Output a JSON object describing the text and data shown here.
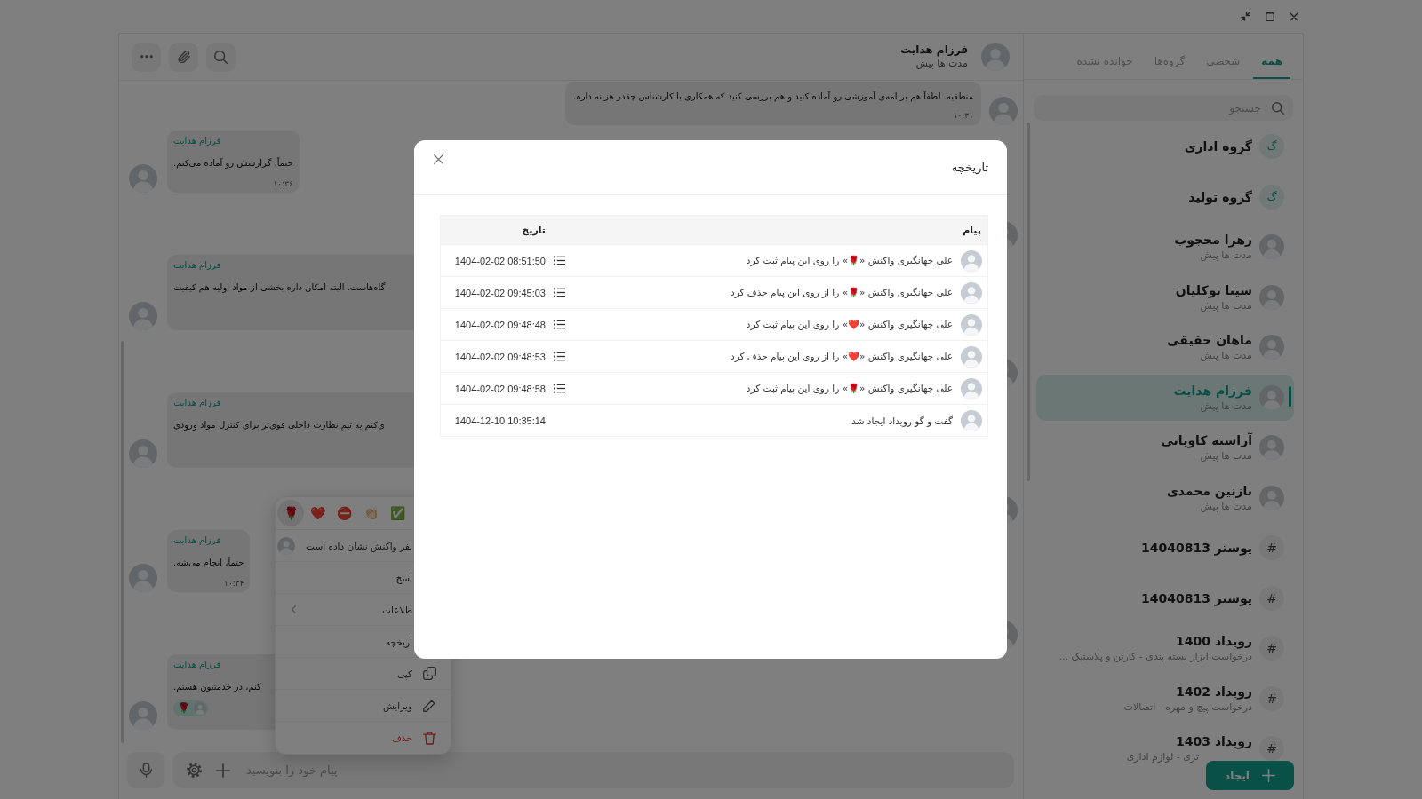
{
  "sidebar": {
    "tabs": [
      {
        "label": "همه",
        "selected": true
      },
      {
        "label": "شخصی",
        "selected": false
      },
      {
        "label": "گروه‌ها",
        "selected": false
      },
      {
        "label": "خوانده نشده",
        "selected": false
      }
    ],
    "search": {
      "placeholder": "جستجو"
    },
    "chats": [
      {
        "kind": "group",
        "badge": "گ",
        "title": "گروه اداری",
        "selected": false
      },
      {
        "kind": "group",
        "badge": "گ",
        "title": "گروه تولید",
        "selected": false
      },
      {
        "kind": "person",
        "title": "زهرا محجوب",
        "subtitle": "مدت ها پیش",
        "selected": false
      },
      {
        "kind": "person",
        "title": "سینا توکلیان",
        "subtitle": "مدت ها پیش",
        "selected": false
      },
      {
        "kind": "person",
        "title": "ماهان حقیقی",
        "subtitle": "مدت ها پیش",
        "selected": false
      },
      {
        "kind": "person",
        "title": "فرزام هدایت",
        "subtitle": "مدت ها پیش",
        "selected": true
      },
      {
        "kind": "person",
        "title": "آراسته کاویانی",
        "subtitle": "مدت ها پیش",
        "selected": false
      },
      {
        "kind": "person",
        "title": "نازنین محمدی",
        "subtitle": "مدت ها پیش",
        "selected": false
      },
      {
        "kind": "channel",
        "badge": "#",
        "title": "پوستر 14040813",
        "selected": false
      },
      {
        "kind": "channel",
        "badge": "#",
        "title": "پوستر 14040813",
        "selected": false
      },
      {
        "kind": "channel",
        "badge": "#",
        "title": "رویداد 1400",
        "subtitle": "درخواست ابزار بسته بندی - کارتن و پلاستیک ...",
        "selected": false
      },
      {
        "kind": "channel",
        "badge": "#",
        "title": "رویداد 1402",
        "subtitle": "درخواست پیچ و مهره - اتصالات",
        "selected": false
      },
      {
        "kind": "channel",
        "badge": "#",
        "title": "رویداد 1403",
        "subtitle": "تری - لوازم اداری",
        "selected": false
      }
    ],
    "create_button": "ایجاد"
  },
  "chat": {
    "header": {
      "name": "فرزام هدایت",
      "status": "مدت ها پیش"
    },
    "messages": [
      {
        "kind": "sent",
        "text": "منطقیه. لطفاً هم برنامه‌ی آموزشی رو آماده کنید و هم بررسی کنید که همکاری با کارشناس چقدر هزینه داره.",
        "time": "۱۰:۳۱"
      },
      {
        "kind": "received",
        "sender": "فرزام هدایت",
        "text": "حتماً، گزارشش رو آماده می‌کنم.",
        "time": "۱۰:۳۶"
      },
      {
        "kind": "covered"
      },
      {
        "kind": "clipped",
        "sender": "فرزام هدایت",
        "text": "گاه‌هاست. البته امکان داره بخشی از مواد اولیه هم کیفیت"
      },
      {
        "kind": "covered"
      },
      {
        "kind": "clipped",
        "sender": "فرزام هدایت",
        "text": "ی‌کنم یه تیم نظارت داخلی قوی‌تر برای کنترل مواد ورودی"
      },
      {
        "kind": "covered"
      },
      {
        "kind": "received",
        "sender": "فرزام هدایت",
        "text": "حتماً، انجام می‌شه.",
        "time": "۱۰:۳۴"
      },
      {
        "kind": "covered"
      },
      {
        "kind": "clipped",
        "sender": "فرزام هدایت",
        "text": "کنم، در خدمتتون هستم.",
        "reactions": [
          {
            "emoji": "🌹"
          }
        ]
      }
    ],
    "composer": {
      "placeholder": "پیام خود را بنویسید"
    }
  },
  "context_menu": {
    "reactions": [
      {
        "emoji": "✅",
        "selected": false
      },
      {
        "emoji": "👏🏻",
        "selected": false
      },
      {
        "emoji": "⛔",
        "selected": false
      },
      {
        "emoji": "❤️",
        "selected": false
      },
      {
        "emoji": "🌹",
        "selected": true
      }
    ],
    "reacted_by": "نفر واکنش نشان داده است",
    "items": [
      {
        "kind": "plain",
        "label": "اسخ"
      },
      {
        "kind": "submenu",
        "label": "طلاعات"
      },
      {
        "kind": "plain",
        "label": "اریخچه"
      },
      {
        "kind": "copy",
        "label": "کپی"
      },
      {
        "kind": "edit",
        "label": "ویرایش"
      },
      {
        "kind": "delete",
        "label": "حذف"
      }
    ]
  },
  "history_dialog": {
    "title": "تاریخچه",
    "columns": [
      "پیام",
      "تاریخ"
    ],
    "rows": [
      {
        "kind": "reaction",
        "text": "علی جهانگیری واکنش «🌹» را روی این پیام ثبت کرد",
        "date": "1404-02-02 08:51:50"
      },
      {
        "kind": "reaction",
        "text": "علی جهانگیری واکنش «🌹» را از روی این پیام حذف کرد",
        "date": "1404-02-02 09:45:03"
      },
      {
        "kind": "reaction",
        "text": "علی جهانگیری واکنش «❤️» را روی این پیام ثبت کرد",
        "date": "1404-02-02 09:48:48"
      },
      {
        "kind": "reaction",
        "text": "علی جهانگیری واکنش «❤️» را از روی این پیام حذف کرد",
        "date": "1404-02-02 09:48:53"
      },
      {
        "kind": "reaction",
        "text": "علی جهانگیری واکنش «🌹» را روی این پیام ثبت کرد",
        "date": "1404-02-02 09:48:58"
      },
      {
        "kind": "event",
        "text": "گفت و گو رویداد ایجاد شد",
        "date": "1404-12-10 10:35:14"
      }
    ]
  }
}
